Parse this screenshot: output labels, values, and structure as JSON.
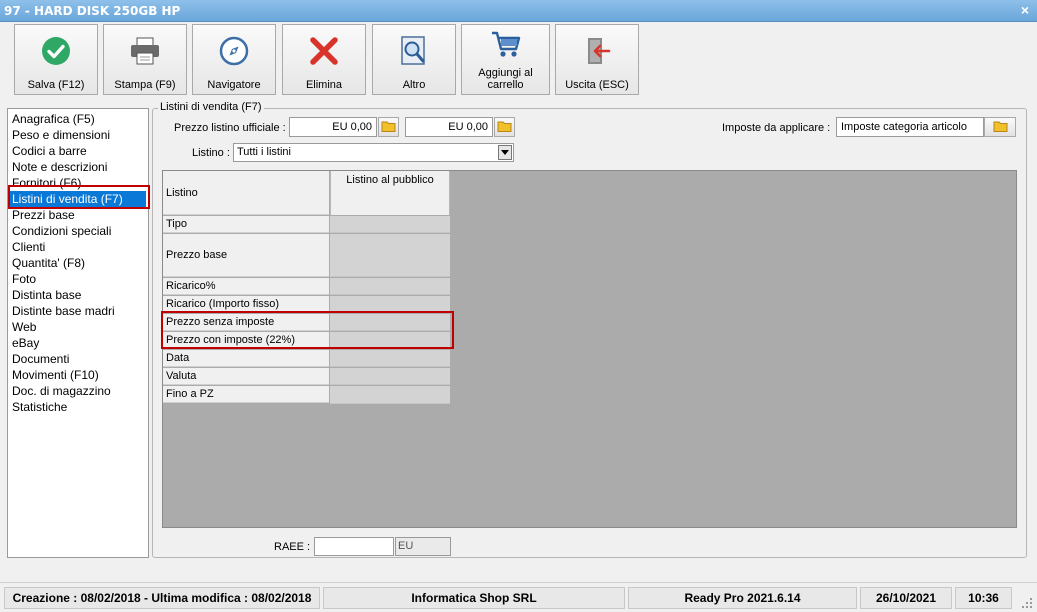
{
  "window": {
    "title": "97 - HARD DISK 250GB HP",
    "close_glyph": "×"
  },
  "toolbar": [
    {
      "label": "Salva (F12)",
      "icon": "check-icon"
    },
    {
      "label": "Stampa (F9)",
      "icon": "printer-icon"
    },
    {
      "label": "Navigatore",
      "icon": "compass-icon"
    },
    {
      "label": "Elimina",
      "icon": "delete-x-icon"
    },
    {
      "label": "Altro",
      "icon": "document-search-icon"
    },
    {
      "label": "Aggiungi al carrello",
      "icon": "cart-icon"
    },
    {
      "label": "Uscita (ESC)",
      "icon": "exit-icon"
    }
  ],
  "nav": {
    "items": [
      "Anagrafica (F5)",
      "Peso e dimensioni",
      "Codici a barre",
      "Note e descrizioni",
      "Fornitori (F6)",
      "Listini di vendita (F7)",
      "Prezzi base",
      "Condizioni speciali",
      "Clienti",
      "Quantita' (F8)",
      "Foto",
      "Distinta base",
      "Distinte base madri",
      "Web",
      "eBay",
      "Documenti",
      "Movimenti (F10)",
      "Doc. di magazzino",
      "Statistiche"
    ],
    "selected_index": 5
  },
  "group": {
    "title": "Listini di vendita (F7)",
    "prezzo_label": "Prezzo listino ufficiale :",
    "prezzo_value1": "EU 0,00",
    "prezzo_value2": "EU 0,00",
    "imposte_label": "Imposte da applicare :",
    "imposte_value": "Imposte categoria articolo",
    "listino_label": "Listino :",
    "listino_value": "Tutti i listini"
  },
  "grid": {
    "column_header": "Listino al pubblico",
    "rows": [
      "Listino",
      "Tipo",
      "Prezzo base",
      "Ricarico%",
      "Ricarico (Importo fisso)",
      "Prezzo senza imposte",
      "Prezzo con imposte (22%)",
      "Data",
      "Valuta",
      "Fino a PZ"
    ]
  },
  "raee": {
    "label": "RAEE :",
    "value": "",
    "unit": "EU"
  },
  "status": {
    "dates": "Creazione : 08/02/2018 - Ultima modifica : 08/02/2018",
    "company": "Informatica Shop SRL",
    "version": "Ready Pro 2021.6.14",
    "date": "26/10/2021",
    "time": "10:36"
  },
  "colors": {
    "highlight_red": "#c00000",
    "selection_blue": "#0a78d7",
    "accent_green": "#2fa866",
    "delete_red": "#d9342b"
  }
}
